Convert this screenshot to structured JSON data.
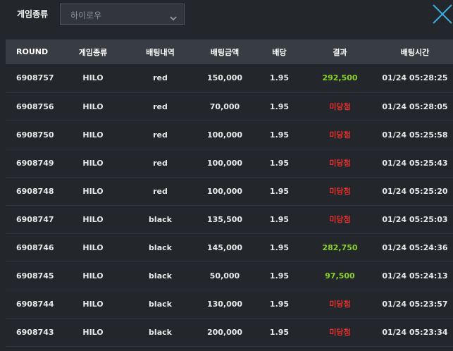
{
  "filter": {
    "label": "게임종류",
    "selected": "하이로우"
  },
  "colors": {
    "background": "#23262b",
    "header_bg": "#383c43",
    "win": "#8bd12c",
    "lose": "#e0322f",
    "close_icon": "#3aa8d8"
  },
  "icons": {
    "close": "close-x-icon",
    "dropdown": "chevron-down-icon"
  },
  "table": {
    "headers": {
      "round": "ROUND",
      "game": "게임종류",
      "bet": "배팅내역",
      "amount": "배팅금액",
      "odds": "배당",
      "result": "결과",
      "time": "배팅시간"
    },
    "rows": [
      {
        "round": "6908757",
        "game": "HILO",
        "bet": "red",
        "amount": "150,000",
        "odds": "1.95",
        "result": "292,500",
        "status": "win",
        "time": "01/24 05:28:25"
      },
      {
        "round": "6908756",
        "game": "HILO",
        "bet": "red",
        "amount": "70,000",
        "odds": "1.95",
        "result": "미당첨",
        "status": "lose",
        "time": "01/24 05:28:05"
      },
      {
        "round": "6908750",
        "game": "HILO",
        "bet": "red",
        "amount": "100,000",
        "odds": "1.95",
        "result": "미당첨",
        "status": "lose",
        "time": "01/24 05:25:58"
      },
      {
        "round": "6908749",
        "game": "HILO",
        "bet": "red",
        "amount": "100,000",
        "odds": "1.95",
        "result": "미당첨",
        "status": "lose",
        "time": "01/24 05:25:43"
      },
      {
        "round": "6908748",
        "game": "HILO",
        "bet": "red",
        "amount": "100,000",
        "odds": "1.95",
        "result": "미당첨",
        "status": "lose",
        "time": "01/24 05:25:20"
      },
      {
        "round": "6908747",
        "game": "HILO",
        "bet": "black",
        "amount": "135,500",
        "odds": "1.95",
        "result": "미당첨",
        "status": "lose",
        "time": "01/24 05:25:03"
      },
      {
        "round": "6908746",
        "game": "HILO",
        "bet": "black",
        "amount": "145,000",
        "odds": "1.95",
        "result": "282,750",
        "status": "win",
        "time": "01/24 05:24:36"
      },
      {
        "round": "6908745",
        "game": "HILO",
        "bet": "black",
        "amount": "50,000",
        "odds": "1.95",
        "result": "97,500",
        "status": "win",
        "time": "01/24 05:24:13"
      },
      {
        "round": "6908744",
        "game": "HILO",
        "bet": "black",
        "amount": "130,000",
        "odds": "1.95",
        "result": "미당첨",
        "status": "lose",
        "time": "01/24 05:23:57"
      },
      {
        "round": "6908743",
        "game": "HILO",
        "bet": "black",
        "amount": "200,000",
        "odds": "1.95",
        "result": "미당첨",
        "status": "lose",
        "time": "01/24 05:23:34"
      }
    ]
  }
}
